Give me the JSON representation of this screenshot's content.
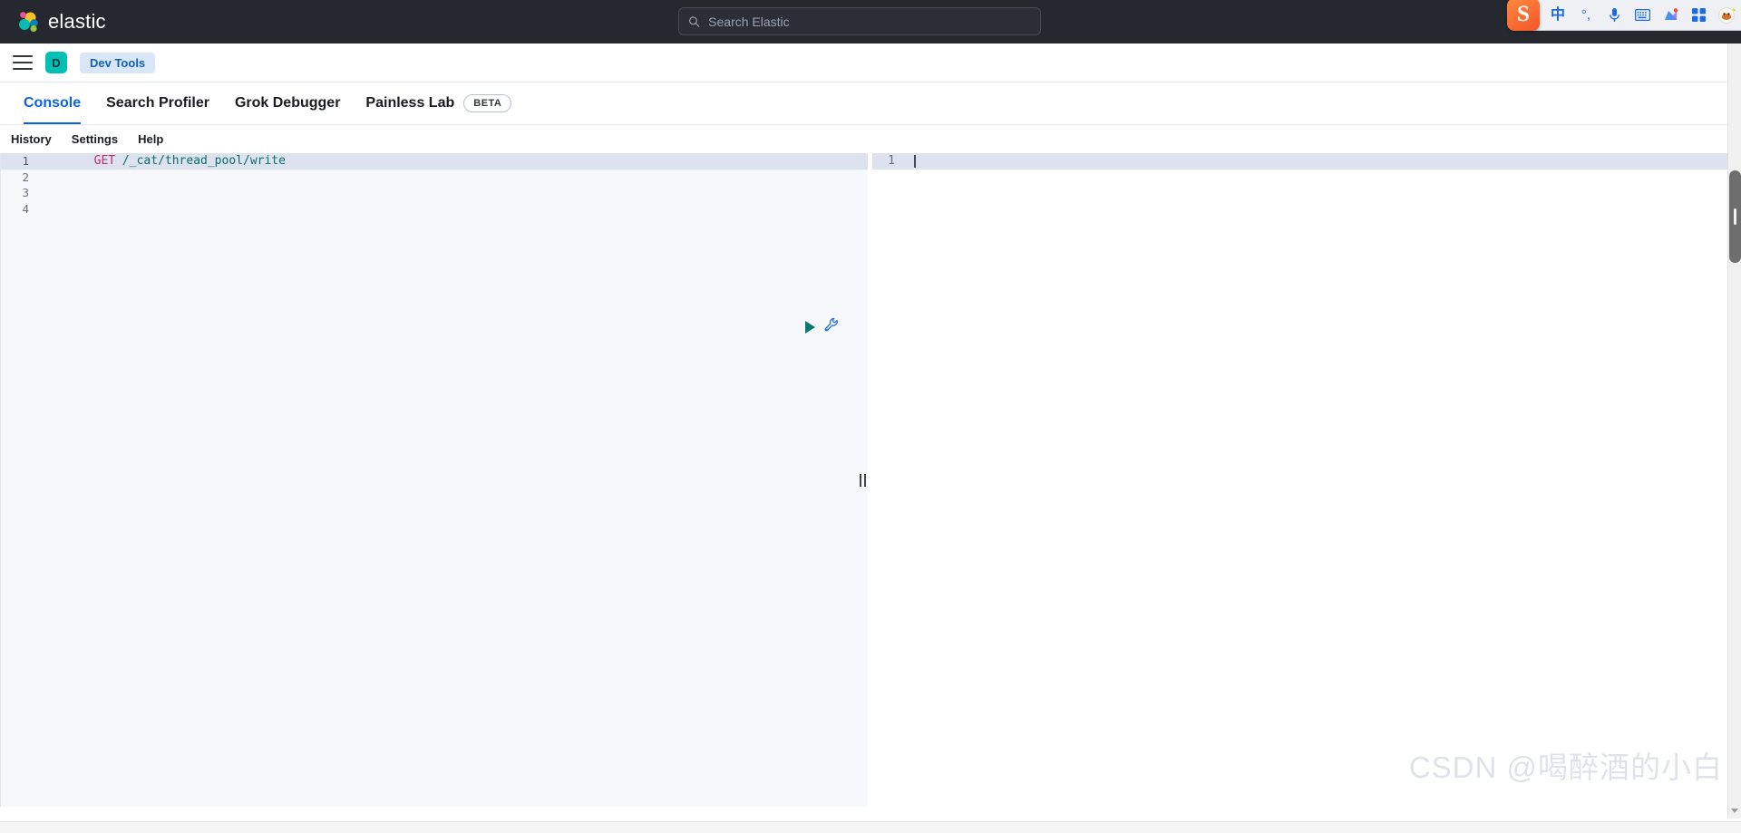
{
  "global_header": {
    "brand": "elastic",
    "logo_icon": "elastic-logo-icon",
    "search": {
      "icon": "search-icon",
      "placeholder": "Search Elastic",
      "value": ""
    },
    "ime_tray": {
      "app": "S",
      "items": [
        {
          "name": "chinese-mode-icon",
          "glyph": "中"
        },
        {
          "name": "punctuation-mode-icon",
          "glyph": "°,"
        },
        {
          "name": "voice-input-icon",
          "glyph": "⬤"
        },
        {
          "name": "soft-keyboard-icon",
          "glyph": "⌨"
        },
        {
          "name": "skin-icon",
          "glyph": "✦"
        },
        {
          "name": "toolbox-icon",
          "glyph": "⬛"
        },
        {
          "name": "mascot-icon",
          "glyph": "●"
        }
      ]
    }
  },
  "app_header": {
    "menu_icon": "hamburger-menu-icon",
    "space_avatar": "D",
    "breadcrumb": "Dev Tools"
  },
  "tabs": [
    {
      "label": "Console",
      "active": true,
      "badge": ""
    },
    {
      "label": "Search Profiler",
      "active": false,
      "badge": ""
    },
    {
      "label": "Grok Debugger",
      "active": false,
      "badge": ""
    },
    {
      "label": "Painless Lab",
      "active": false,
      "badge": "BETA"
    }
  ],
  "console_menu": [
    {
      "label": "History"
    },
    {
      "label": "Settings"
    },
    {
      "label": "Help"
    }
  ],
  "editor": {
    "actions": {
      "play": "play-request-icon",
      "wrench": "request-options-icon"
    },
    "request_lines": [
      {
        "number": "1",
        "method": "GET",
        "path": " /_cat/thread_pool/write",
        "highlight": true
      },
      {
        "number": "2",
        "method": "",
        "path": "",
        "highlight": false
      },
      {
        "number": "3",
        "method": "",
        "path": "",
        "highlight": false
      },
      {
        "number": "4",
        "method": "",
        "path": "",
        "highlight": false
      }
    ],
    "response_lines": [
      {
        "number": "1",
        "text": ""
      }
    ],
    "splitter": "panel-splitter-handle"
  },
  "watermark": "CSDN @喝醉酒的小白",
  "colors": {
    "accent": "#0b64dd",
    "header_bg": "#25282f",
    "space_avatar_bg": "#00bfb3",
    "breadcrumb_bg": "#d9e6f6",
    "method_token": "#c42a6b",
    "url_token": "#0a6e6e",
    "play_icon": "#087b6c",
    "highlight_row": "#dde3ee"
  }
}
